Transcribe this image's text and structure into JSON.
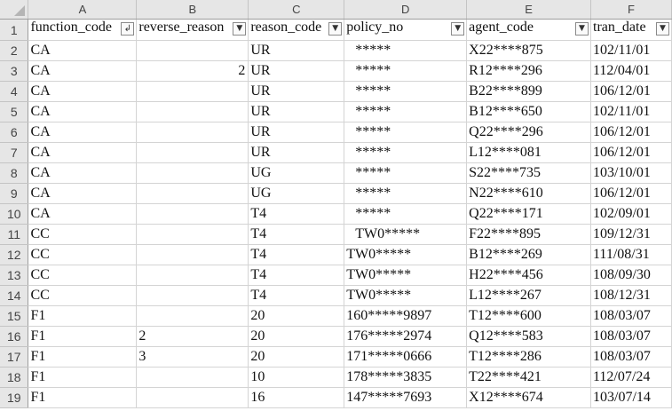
{
  "columns": [
    "A",
    "B",
    "C",
    "D",
    "E",
    "F"
  ],
  "rows": [
    {
      "num": "1",
      "cells": [
        "function_code",
        "reverse_reason",
        "reason_code",
        "policy_no",
        "agent_code",
        "tran_date"
      ]
    },
    {
      "num": "2",
      "cells": [
        "CA",
        "",
        "UR",
        "*****",
        "X22****875",
        "102/11/01"
      ]
    },
    {
      "num": "3",
      "cells": [
        "CA",
        "2",
        "UR",
        "*****",
        "R12****296",
        "112/04/01"
      ]
    },
    {
      "num": "4",
      "cells": [
        "CA",
        "",
        "UR",
        "*****",
        "B22****899",
        "106/12/01"
      ]
    },
    {
      "num": "5",
      "cells": [
        "CA",
        "",
        "UR",
        "*****",
        "B12****650",
        "102/11/01"
      ]
    },
    {
      "num": "6",
      "cells": [
        "CA",
        "",
        "UR",
        "*****",
        "Q22****296",
        "106/12/01"
      ]
    },
    {
      "num": "7",
      "cells": [
        "CA",
        "",
        "UR",
        "*****",
        "L12****081",
        "106/12/01"
      ]
    },
    {
      "num": "8",
      "cells": [
        "CA",
        "",
        "UG",
        "*****",
        "S22****735",
        "103/10/01"
      ]
    },
    {
      "num": "9",
      "cells": [
        "CA",
        "",
        "UG",
        "*****",
        "N22****610",
        "106/12/01"
      ]
    },
    {
      "num": "10",
      "cells": [
        "CA",
        "",
        "T4",
        "*****",
        "Q22****171",
        "102/09/01"
      ]
    },
    {
      "num": "11",
      "cells": [
        "CC",
        "",
        "T4",
        "TW0*****",
        "F22****895",
        "109/12/31"
      ]
    },
    {
      "num": "12",
      "cells": [
        "CC",
        "",
        "T4",
        "TW0*****",
        "B12****269",
        "111/08/31"
      ]
    },
    {
      "num": "13",
      "cells": [
        "CC",
        "",
        "T4",
        "TW0*****",
        "H22****456",
        "108/09/30"
      ]
    },
    {
      "num": "14",
      "cells": [
        "CC",
        "",
        "T4",
        "TW0*****",
        "L12****267",
        "108/12/31"
      ]
    },
    {
      "num": "15",
      "cells": [
        "F1",
        "",
        "20",
        "160*****9897",
        "T12****600",
        "108/03/07"
      ]
    },
    {
      "num": "16",
      "cells": [
        "F1",
        "2",
        "20",
        "176*****2974",
        "Q12****583",
        "108/03/07"
      ]
    },
    {
      "num": "17",
      "cells": [
        "F1",
        "3",
        "20",
        "171*****0666",
        "T12****286",
        "108/03/07"
      ]
    },
    {
      "num": "18",
      "cells": [
        "F1",
        "",
        "10",
        "178*****3835",
        "T22****421",
        "112/07/24"
      ]
    },
    {
      "num": "19",
      "cells": [
        "F1",
        "",
        "16",
        "147*****7693",
        "X12****674",
        "103/07/14"
      ]
    }
  ],
  "filter_icons": [
    "filter-sorted-icon",
    "filter-dropdown-icon",
    "filter-dropdown-icon",
    "filter-dropdown-icon",
    "filter-dropdown-icon",
    "filter-dropdown-icon"
  ]
}
